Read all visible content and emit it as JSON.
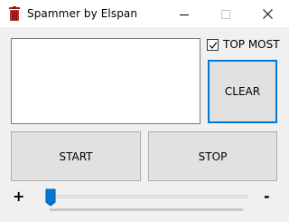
{
  "window": {
    "title": "Spammer by Elspan",
    "icon": "trash-bin-icon",
    "controls": [
      "minimize-icon",
      "maximize-icon",
      "close-icon"
    ]
  },
  "message_box": {
    "value": ""
  },
  "top_most": {
    "label": "TOP MOST",
    "checked": true
  },
  "buttons": {
    "clear": "CLEAR",
    "start": "START",
    "stop": "STOP"
  },
  "speed_slider": {
    "plus_label": "+",
    "minus_label": "-",
    "value_fraction": 0.0
  },
  "colors": {
    "accent": "#0078d7",
    "icon_red": "#c0392b"
  }
}
